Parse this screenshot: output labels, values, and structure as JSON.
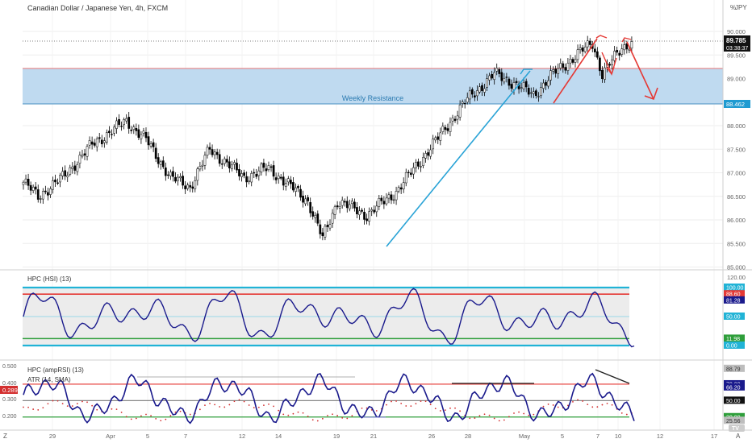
{
  "header": {
    "title": "Canadian Dollar / Japanese Yen, 4h, FXCM",
    "currency": "JPY",
    "scale_label": "%"
  },
  "zone": {
    "label": "Weekly Resistance",
    "top": 89.2,
    "bottom": 88.5
  },
  "price_badge": {
    "price": "89.785",
    "countdown": "03:38:37"
  },
  "zone_badge": "88.462",
  "colors": {
    "bull": "#ffffff",
    "bear": "#000000",
    "wick": "#000000",
    "trend_line": "#29a3d6",
    "annotation": "#e53935",
    "zone_fill": "#bfdaf0",
    "zone_border": "#e57373",
    "osc_line": "#1a1a8c",
    "osc_band_cyan": "#21b3d6",
    "osc_red": "#e53935",
    "osc_green": "#2e9e3a",
    "atr_dots": "#d32f2f",
    "grid": "#eeeeee",
    "panel_border": "#cfcfcf"
  },
  "chart_data": [
    {
      "type": "candlestick",
      "title": "Canadian Dollar / Japanese Yen, 4h, FXCM",
      "x_labels": [
        "29",
        "Apr",
        "5",
        "7",
        "12",
        "14",
        "19",
        "21",
        "26",
        "28",
        "May",
        "5",
        "7",
        "10",
        "12",
        "17"
      ],
      "y_ticks": [
        "85.000",
        "85.500",
        "86.000",
        "86.500",
        "87.000",
        "87.500",
        "88.000",
        "89.000",
        "89.500",
        "90.000"
      ],
      "ylim": [
        84.95,
        90.55
      ],
      "key_points": [
        {
          "index": 0,
          "close": 86.8
        },
        {
          "index": 6,
          "close": 86.5
        },
        {
          "index": 16,
          "close": 86.9
        },
        {
          "index": 28,
          "close": 87.6
        },
        {
          "index": 42,
          "close": 88.1
        },
        {
          "index": 50,
          "close": 87.7
        },
        {
          "index": 60,
          "close": 86.9
        },
        {
          "index": 68,
          "close": 86.7
        },
        {
          "index": 76,
          "close": 87.5
        },
        {
          "index": 90,
          "close": 86.9
        },
        {
          "index": 100,
          "close": 87.1
        },
        {
          "index": 116,
          "close": 86.4
        },
        {
          "index": 122,
          "close": 85.6
        },
        {
          "index": 128,
          "close": 86.4
        },
        {
          "index": 140,
          "close": 86.1
        },
        {
          "index": 152,
          "close": 86.6
        },
        {
          "index": 170,
          "close": 87.8
        },
        {
          "index": 180,
          "close": 88.5
        },
        {
          "index": 192,
          "close": 89.1
        },
        {
          "index": 200,
          "close": 88.9
        },
        {
          "index": 208,
          "close": 88.65
        },
        {
          "index": 216,
          "close": 89.1
        },
        {
          "index": 228,
          "close": 89.6
        },
        {
          "index": 232,
          "close": 89.75
        },
        {
          "index": 236,
          "close": 89.1
        },
        {
          "index": 244,
          "close": 89.65
        },
        {
          "index": 248,
          "close": 89.785
        }
      ],
      "last_price": 89.785,
      "annotations": [
        "Weekly Resistance",
        "ascending trendline from 85.5 to 89.2",
        "projected drop to about 88.6"
      ]
    },
    {
      "type": "line",
      "title": "HPC (HSI) (13)",
      "y_ticks": [
        "120.00"
      ],
      "levels": [
        100,
        88.6,
        50,
        11.98,
        0
      ],
      "level_labels": [
        "100.00",
        "88.60",
        "81.28",
        "50.00",
        "11.98",
        "0.00"
      ],
      "last_value": 81.28,
      "ylim": [
        -18,
        122
      ]
    },
    {
      "type": "line",
      "title": "HPC (ampRSI) (13)",
      "subtitle": "ATR (14, SMA)",
      "left_ticks": [
        "0.500",
        "0.400",
        "0.300",
        "0.200"
      ],
      "left_badge": "0.289",
      "right_labels": [
        "88.79",
        "70.00",
        "66.20",
        "50.00",
        "30.00",
        "25.56"
      ],
      "levels": [
        70,
        50,
        30
      ],
      "ylim": [
        18,
        95
      ]
    }
  ],
  "x_axis_corner": "Z",
  "corner_label": "A",
  "tv_logo": "TV"
}
